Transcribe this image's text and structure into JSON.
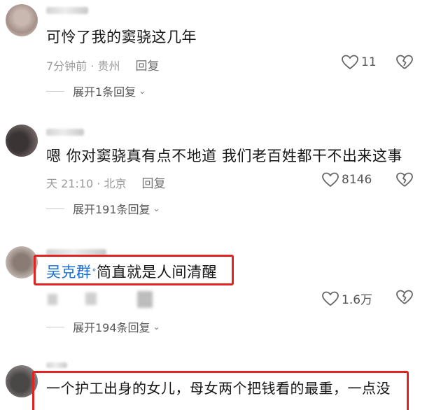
{
  "comments": [
    {
      "username": "",
      "text": "可怜了我的窦骁这几年",
      "meta": "7分钟前 · 贵州",
      "reply_label": "回复",
      "likes": "11",
      "expand_label": "展开1条回复"
    },
    {
      "username": "",
      "text": "嗯 你对窦骁真有点不地道 我们老百姓都干不出来这事",
      "meta": "天 21:10 · 北京",
      "reply_label": "回复",
      "likes": "8146",
      "expand_label": "展开191条回复"
    },
    {
      "username": "",
      "mention": "吴克群",
      "text": "简直就是人间清醒",
      "likes": "1.6万",
      "expand_label": "展开194条回复"
    },
    {
      "username": "",
      "text": "一个护工出身的女儿，母女两个把钱看的最重，一点没"
    }
  ],
  "colors": {
    "highlight_border": "#e02424",
    "mention": "#1a6fd6",
    "meta": "#9a9a9a"
  },
  "icons": [
    "heart-icon",
    "broken-heart-icon",
    "chevron-down-icon",
    "verified-badge-icon"
  ]
}
